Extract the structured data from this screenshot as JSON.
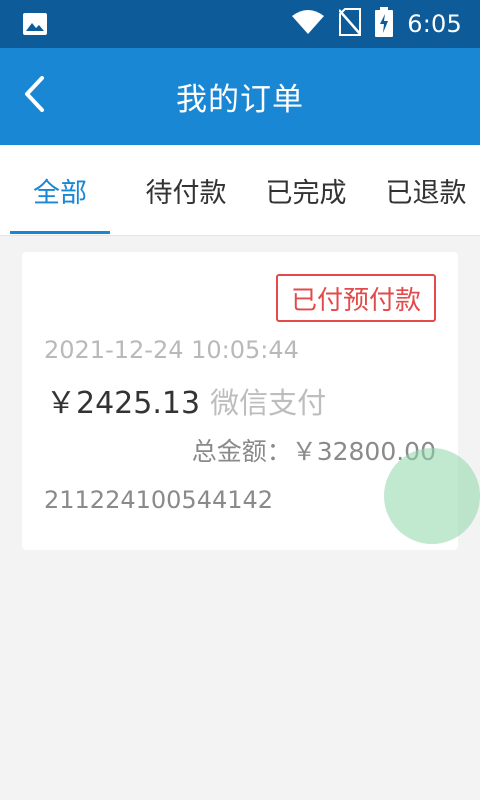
{
  "status_bar": {
    "time": "6:05",
    "icons": [
      "image-icon",
      "wifi-icon",
      "no-sim-icon",
      "battery-charging-icon"
    ]
  },
  "header": {
    "title": "我的订单",
    "back_icon": "chevron-left-icon"
  },
  "tabs": [
    {
      "label": "全部",
      "active": true
    },
    {
      "label": "待付款",
      "active": false
    },
    {
      "label": "已完成",
      "active": false
    },
    {
      "label": "已退款",
      "active": false
    }
  ],
  "order": {
    "status": "已付预付款",
    "datetime": "2021-12-24 10:05:44",
    "amount": "￥2425.13",
    "payment_method": "微信支付",
    "total": "总金额：￥32800.00",
    "order_number": "211224100544142"
  },
  "colors": {
    "status_bar": "#0d5b99",
    "toolbar": "#1a87d5",
    "accent": "#1a87d5",
    "badge": "#e34a4a"
  }
}
